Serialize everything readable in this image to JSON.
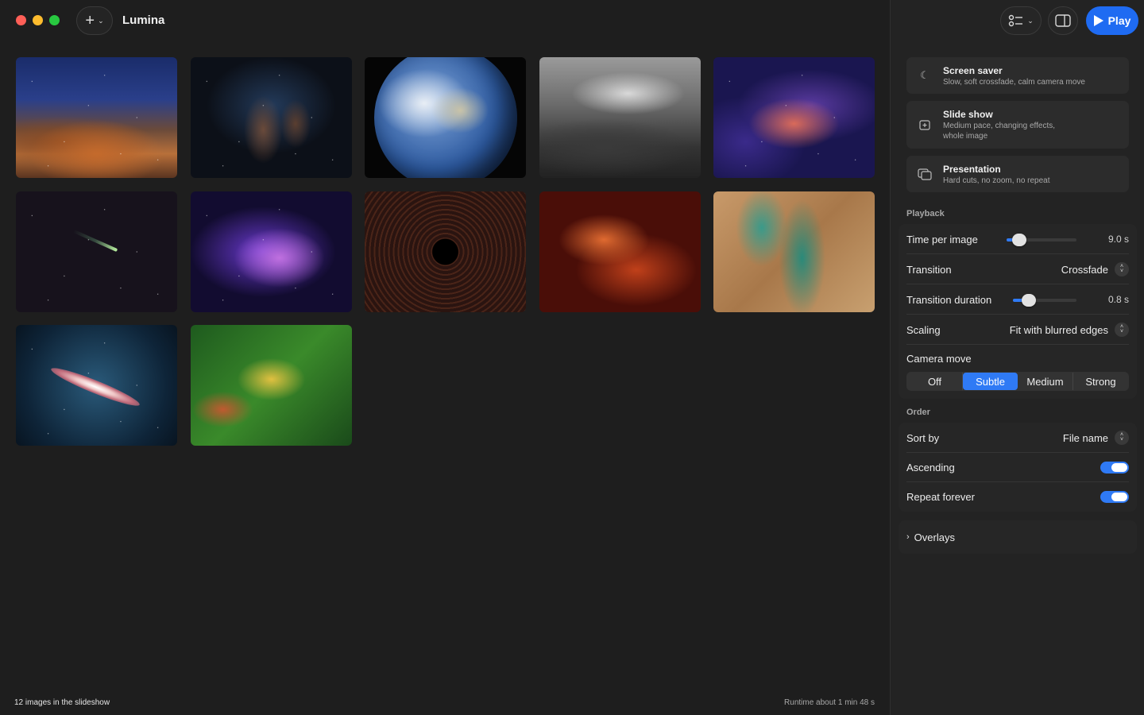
{
  "app": {
    "title": "Lumina"
  },
  "toolbar": {
    "play_label": "Play"
  },
  "images": [
    {
      "id": "t1"
    },
    {
      "id": "t2"
    },
    {
      "id": "t3"
    },
    {
      "id": "t4"
    },
    {
      "id": "t5"
    },
    {
      "id": "t6"
    },
    {
      "id": "t7"
    },
    {
      "id": "t8"
    },
    {
      "id": "t9"
    },
    {
      "id": "t10"
    },
    {
      "id": "t11"
    },
    {
      "id": "t12"
    }
  ],
  "footer": {
    "count_text": "12 images in the slideshow",
    "runtime_text": "Runtime about 1 min 48 s"
  },
  "presets": [
    {
      "title": "Screen saver",
      "subtitle": "Slow, soft crossfade, calm camera move",
      "icon": "moon-icon"
    },
    {
      "title": "Slide show",
      "subtitle_line1": "Medium pace, changing effects,",
      "subtitle_line2": "whole image",
      "icon": "slideshow-icon"
    },
    {
      "title": "Presentation",
      "subtitle": "Hard cuts, no zoom, no repeat",
      "icon": "presentation-icon"
    }
  ],
  "playback": {
    "section_label": "Playback",
    "time_per_image": {
      "label": "Time per image",
      "value": "9.0 s",
      "fraction": 0.18
    },
    "transition": {
      "label": "Transition",
      "value": "Crossfade"
    },
    "transition_duration": {
      "label": "Transition duration",
      "value": "0.8 s",
      "fraction": 0.25
    },
    "scaling": {
      "label": "Scaling",
      "value": "Fit with blurred edges"
    },
    "camera_move": {
      "label": "Camera move",
      "options": [
        "Off",
        "Subtle",
        "Medium",
        "Strong"
      ],
      "selected": "Subtle"
    }
  },
  "order": {
    "section_label": "Order",
    "sort_by": {
      "label": "Sort by",
      "value": "File name"
    },
    "ascending": {
      "label": "Ascending",
      "on": true
    },
    "repeat_forever": {
      "label": "Repeat forever",
      "on": true
    }
  },
  "overlays": {
    "label": "Overlays"
  },
  "colors": {
    "accent": "#2f7af5",
    "play": "#1f6bf2"
  }
}
